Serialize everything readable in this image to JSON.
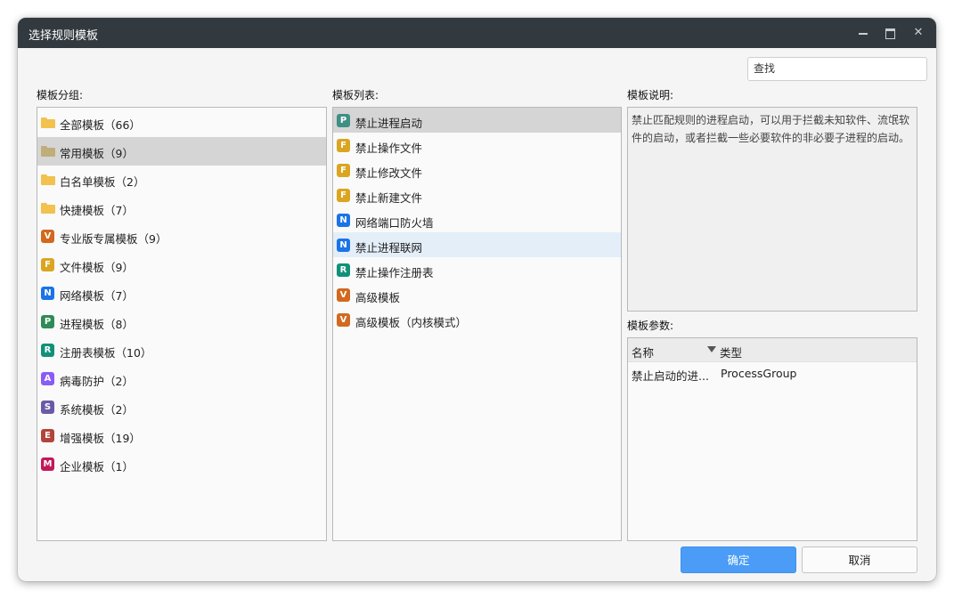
{
  "window": {
    "title": "选择规则模板"
  },
  "colors": {
    "titlebar": "#323a40",
    "accent": "#4a9cf6",
    "badge_V": "#d2691e",
    "badge_F": "#daa520",
    "badge_N": "#1a73e8",
    "badge_P": "#2e8b57",
    "badge_R": "#129079",
    "badge_A": "#8a5cf6",
    "badge_S": "#6b5aa6",
    "badge_E": "#b2443c",
    "badge_M": "#c2185b",
    "folder": "#f2c14e",
    "folder_selected": "#bfae79"
  },
  "search": {
    "placeholder": "查找"
  },
  "groups": {
    "label": "模板分组:",
    "items": [
      {
        "label": "全部模板（66）",
        "icon": "folder-icon"
      },
      {
        "label": "常用模板（9）",
        "icon": "folder-icon"
      },
      {
        "label": "白名单模板（2）",
        "icon": "folder-icon"
      },
      {
        "label": "快捷模板（7）",
        "icon": "folder-icon"
      },
      {
        "label": "专业版专属模板（9）",
        "icon": "V"
      },
      {
        "label": "文件模板（9）",
        "icon": "F"
      },
      {
        "label": "网络模板（7）",
        "icon": "N"
      },
      {
        "label": "进程模板（8）",
        "icon": "P"
      },
      {
        "label": "注册表模板（10）",
        "icon": "R"
      },
      {
        "label": "病毒防护（2）",
        "icon": "A"
      },
      {
        "label": "系统模板（2）",
        "icon": "S"
      },
      {
        "label": "增强模板（19）",
        "icon": "E"
      },
      {
        "label": "企业模板（1）",
        "icon": "M"
      }
    ]
  },
  "templates": {
    "label": "模板列表:",
    "items": [
      {
        "label": "禁止进程启动",
        "icon": "P"
      },
      {
        "label": "禁止操作文件",
        "icon": "F"
      },
      {
        "label": "禁止修改文件",
        "icon": "F"
      },
      {
        "label": "禁止新建文件",
        "icon": "F"
      },
      {
        "label": "网络端口防火墙",
        "icon": "N"
      },
      {
        "label": "禁止进程联网",
        "icon": "N"
      },
      {
        "label": "禁止操作注册表",
        "icon": "R"
      },
      {
        "label": "高级模板",
        "icon": "V"
      },
      {
        "label": "高级模板（内核模式）",
        "icon": "V"
      }
    ]
  },
  "description": {
    "label": "模板说明:",
    "text": "禁止匹配规则的进程启动，可以用于拦截未知软件、流氓软件的启动，或者拦截一些必要软件的非必要子进程的启动。"
  },
  "params": {
    "label": "模板参数:",
    "col_name": "名称",
    "col_type": "类型",
    "rows": [
      {
        "name": "禁止启动的进...",
        "type": "ProcessGroup"
      }
    ]
  },
  "buttons": {
    "ok": "确定",
    "cancel": "取消"
  }
}
